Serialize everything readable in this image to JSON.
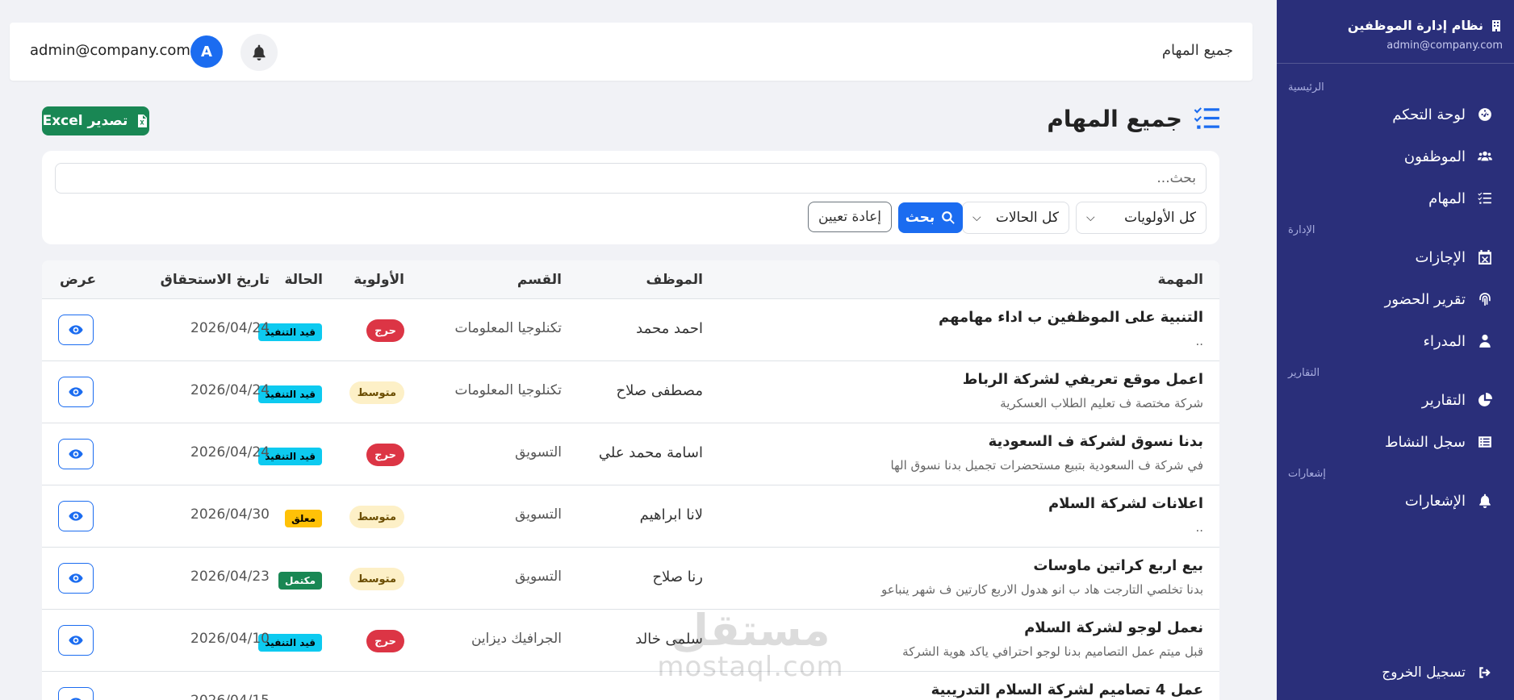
{
  "sidebar": {
    "brand_title": "نظام إدارة الموظفين",
    "brand_email": "admin@company.com",
    "sections": {
      "main": "الرئيسية",
      "admin": "الإدارة",
      "reports": "التقارير",
      "notifications": "إشعارات"
    },
    "items": {
      "dashboard": "لوحة التحكم",
      "employees": "الموظفون",
      "tasks": "المهام",
      "leaves": "الإجازات",
      "attendance": "تقرير الحضور",
      "managers": "المدراء",
      "reports": "التقارير",
      "activity": "سجل النشاط",
      "notifications": "الإشعارات",
      "logout": "تسجيل الخروج"
    }
  },
  "topbar": {
    "title": "جميع المهام",
    "user_email": "admin@company.com",
    "avatar_initial": "A"
  },
  "page": {
    "heading": "جميع المهام",
    "export_label": "تصدير Excel"
  },
  "filters": {
    "search_placeholder": "بحث...",
    "priority_select": "كل الأولويات",
    "status_select": "كل الحالات",
    "search_button": "بحث",
    "reset_button": "إعادة تعيين"
  },
  "table": {
    "headers": {
      "task": "المهمة",
      "employee": "الموظف",
      "department": "القسم",
      "priority": "الأولوية",
      "status": "الحالة",
      "due": "تاريخ الاستحقاق",
      "view": "عرض"
    },
    "rows": [
      {
        "title": "التنبية على الموظفين ب اداء مهامهم",
        "desc": "..",
        "employee": "احمد محمد",
        "department": "تكنلوجيا المعلومات",
        "priority": "حرج",
        "status": "قيد التنفيذ",
        "due": "2026/04/24"
      },
      {
        "title": "اعمل موقع تعريفي لشركة الرباط",
        "desc": "شركة مختصة ف تعليم الطلاب العسكرية",
        "employee": "مصطفى صلاح",
        "department": "تكنلوجيا المعلومات",
        "priority": "متوسط",
        "status": "قيد التنفيذ",
        "due": "2026/04/24"
      },
      {
        "title": "بدنا نسوق لشركة ف السعودية",
        "desc": "في شركة ف السعودية بتبيع مستحضرات تجميل بدنا نسوق الها",
        "employee": "اسامة محمد علي",
        "department": "التسويق",
        "priority": "حرج",
        "status": "قيد التنفيذ",
        "due": "2026/04/24"
      },
      {
        "title": "اعلانات لشركة السلام",
        "desc": "..",
        "employee": "لانا ابراهيم",
        "department": "التسويق",
        "priority": "متوسط",
        "status": "معلق",
        "due": "2026/04/30"
      },
      {
        "title": "بيع اربع كراتين ماوسات",
        "desc": "بدنا تخلصي التارجت هاد ب انو هدول الاربع كارتين ف شهر ينباعو",
        "employee": "رنا صلاح",
        "department": "التسويق",
        "priority": "متوسط",
        "status": "مكتمل",
        "due": "2026/04/23"
      },
      {
        "title": "نعمل لوجو لشركة السلام",
        "desc": "قبل ميتم عمل التصاميم بدنا لوجو احترافي ياكد هوية الشركة",
        "employee": "سلمى خالد",
        "department": "الجرافيك ديزاين",
        "priority": "حرج",
        "status": "قيد التنفيذ",
        "due": "2026/04/10"
      },
      {
        "title": "عمل 4 تصاميم لشركة السلام التدريبية",
        "desc": "",
        "employee": "",
        "department": "",
        "priority": "",
        "status": "",
        "due": "2026/04/15"
      }
    ]
  },
  "watermark": {
    "arabic": "مستقل",
    "latin": "mostaql.com"
  },
  "colors": {
    "sidebar": "#2a2f7a",
    "primary": "#1b6cf0",
    "success": "#198754",
    "danger": "#dc3545",
    "info": "#0dcaf0",
    "warning": "#ffc107"
  }
}
